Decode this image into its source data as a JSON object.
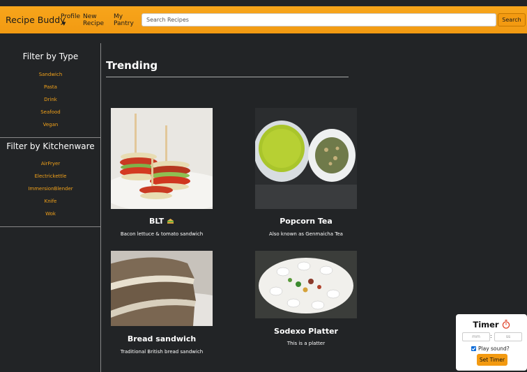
{
  "header": {
    "brand": "Recipe Buddy",
    "nav": {
      "profile": "Profile",
      "new_recipe_1": "New",
      "new_recipe_2": "Recipe",
      "pantry_1": "My",
      "pantry_2": "Pantry"
    },
    "search_placeholder": "Search Recipes",
    "search_button": "Search"
  },
  "sidebar": {
    "type_heading": "Filter by Type",
    "types": [
      "Sandwich",
      "Pasta",
      "Drink",
      "Seafood",
      "Vegan"
    ],
    "kitchenware_heading": "Filter by Kitchenware",
    "kitchenware": [
      "AirFryer",
      "Electrickettle",
      "ImmersionBlender",
      "Knife",
      "Wok"
    ]
  },
  "main": {
    "heading": "Trending",
    "cards": [
      {
        "title": "BLT",
        "desc": "Bacon lettuce & tomato sandwich",
        "icon": "sandwich-icon"
      },
      {
        "title": "Popcorn Tea",
        "desc": "Also known as Genmaicha Tea"
      },
      {
        "title": "Bread sandwich",
        "desc": "Traditional British bread sandwich"
      },
      {
        "title": "Sodexo Platter",
        "desc": "This is a platter"
      }
    ]
  },
  "timer": {
    "title": "Timer",
    "icon": "stopwatch-icon",
    "mm_placeholder": "mm",
    "ss_placeholder": "ss",
    "colon": ":",
    "play_sound": "Play sound?",
    "play_sound_checked": true,
    "set_button": "Set Timer"
  },
  "colors": {
    "accent": "#f39a11",
    "background": "#222426",
    "link": "#f2a21a"
  }
}
